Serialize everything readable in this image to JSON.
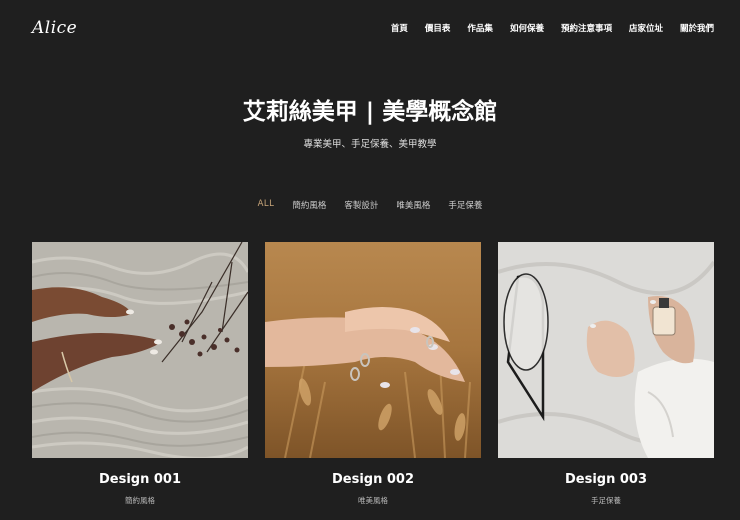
{
  "header": {
    "logo": "Alice",
    "nav": [
      {
        "id": "home",
        "label": "首頁"
      },
      {
        "id": "pricing",
        "label": "價目表"
      },
      {
        "id": "portfolio",
        "label": "作品集"
      },
      {
        "id": "care",
        "label": "如何保養"
      },
      {
        "id": "booking",
        "label": "預約注意事項"
      },
      {
        "id": "location",
        "label": "店家位址"
      },
      {
        "id": "about",
        "label": "關於我們"
      }
    ]
  },
  "hero": {
    "title": "艾莉絲美甲 | 美學概念館",
    "subtitle": "專業美甲、手足保養、美甲教學"
  },
  "filters": [
    {
      "id": "all",
      "label": "ALL",
      "active": true
    },
    {
      "id": "simple",
      "label": "簡約風格",
      "active": false
    },
    {
      "id": "custom",
      "label": "客製設計",
      "active": false
    },
    {
      "id": "aesthetic",
      "label": "唯美風格",
      "active": false
    },
    {
      "id": "handfoot",
      "label": "手足保養",
      "active": false
    }
  ],
  "cards": [
    {
      "title": "Design 001",
      "tag": "簡約風格",
      "image": "hands-on-knit-blanket-with-dried-flowers"
    },
    {
      "title": "Design 002",
      "tag": "唯美風格",
      "image": "hands-with-rings-in-wheat-field"
    },
    {
      "title": "Design 003",
      "tag": "手足保養",
      "image": "hands-holding-perfume-bottle-near-mirror"
    }
  ],
  "colors": {
    "background": "#1f1f1f",
    "accent": "#c8a57a",
    "text": "#ffffff"
  }
}
